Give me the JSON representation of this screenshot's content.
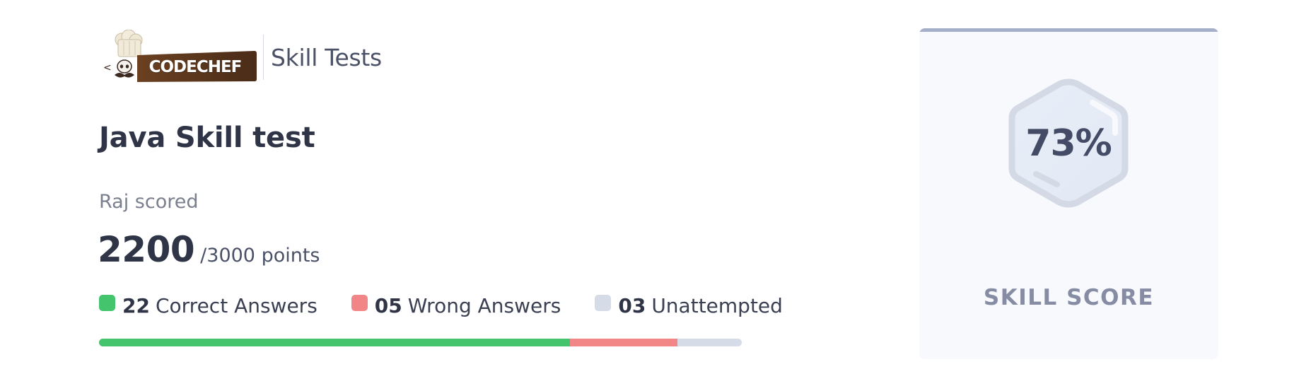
{
  "header": {
    "logo_text": "CODECHEF",
    "product": "Skill Tests"
  },
  "test": {
    "title": "Java Skill test",
    "scored_by": "Raj scored",
    "score": "2200",
    "total": "/3000 points"
  },
  "stats": [
    {
      "count": "22",
      "label": "Correct Answers",
      "color": "#45c46e"
    },
    {
      "count": "05",
      "label": "Wrong Answers",
      "color": "#f28686"
    },
    {
      "count": "03",
      "label": "Unattempted",
      "color": "#d5dbe7"
    }
  ],
  "progress": {
    "correct_fraction": 0.733,
    "wrong_fraction": 0.167,
    "unattempted_fraction": 0.1
  },
  "card": {
    "percent": "73%",
    "label": "SKILL SCORE",
    "accent": "#a4afca"
  }
}
